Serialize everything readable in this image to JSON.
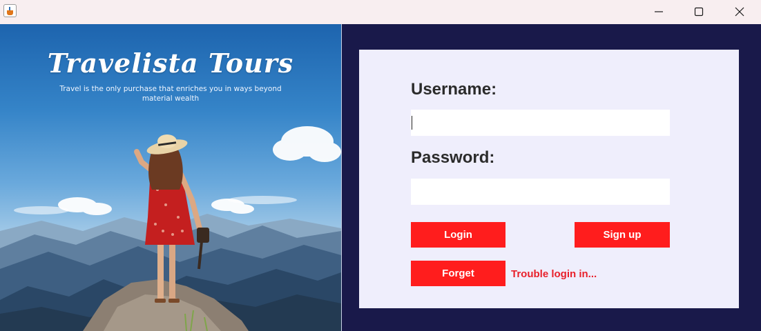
{
  "window": {
    "controls": {
      "minimize_icon": "minimize-icon",
      "maximize_icon": "maximize-icon",
      "close_icon": "close-icon"
    }
  },
  "banner": {
    "title": "Travelista Tours",
    "tagline": "Travel is the only purchase that enriches you in ways beyond material wealth"
  },
  "login": {
    "username_label": "Username:",
    "username_value": "",
    "password_label": "Password:",
    "password_value": "",
    "login_button": "Login",
    "signup_button": "Sign up",
    "forget_button": "Forget",
    "trouble_link": "Trouble login in..."
  },
  "colors": {
    "accent_red": "#ff1d1d",
    "link_red": "#e8202a",
    "panel_dark": "#19194a",
    "card_bg": "#efeefc"
  }
}
